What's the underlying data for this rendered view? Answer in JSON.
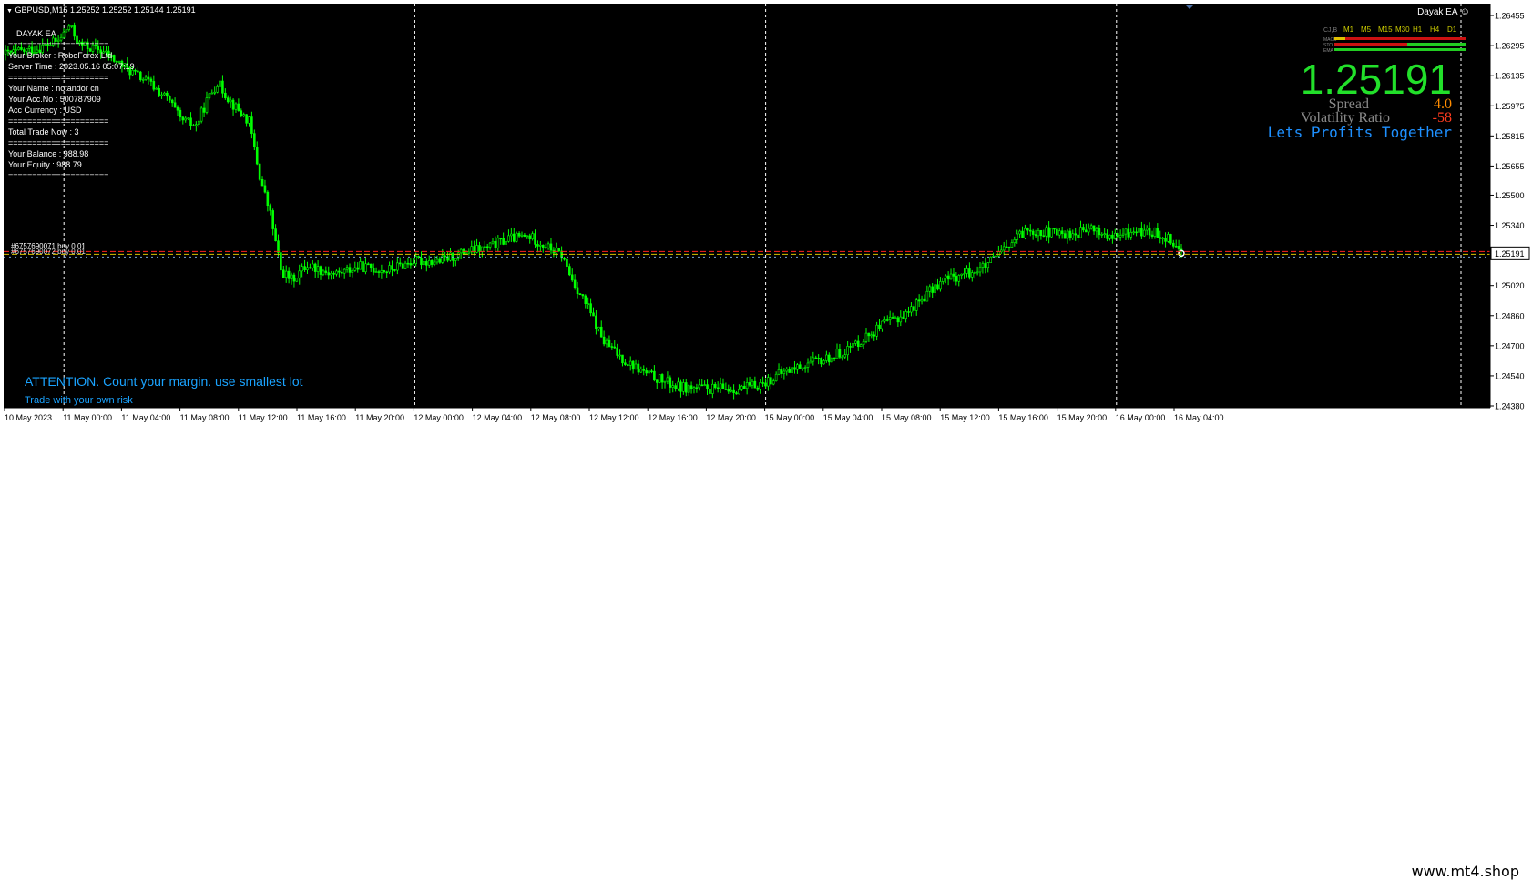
{
  "header": {
    "symbol_line": "GBPUSD,M15  1.25252 1.25252 1.25144 1.25191",
    "ea_badge": "Dayak EA",
    "smiley_icon": "smiley-face-icon"
  },
  "info_panel": {
    "title": "DAYAK EA",
    "lines": [
      "=====================",
      "Your Broker  : RoboForex Ltd",
      "Server Time : 2023.05.16 05:07:19",
      "=====================",
      "Your Name     : notandor cn",
      "Your Acc.No   : 500787909",
      "Acc Currency  : USD",
      "=====================",
      "Total Trade Now : 3",
      "=====================",
      "Your Balance  : 988.98",
      "Your Equity    : 988.79",
      "====================="
    ]
  },
  "order_labels": {
    "line1": "#6757690071 buy 0.01",
    "line2": "#6757690072 buy 0.01"
  },
  "price_panel": {
    "big_price": "1.25191",
    "spread_label": "Spread",
    "spread_value": "4.0",
    "volatility_label": "Volatility Ratio",
    "volatility_value": "-58",
    "slogan": "Lets Profits Together",
    "tf_labels": [
      "M1",
      "M5",
      "M15",
      "M30",
      "H1",
      "H4",
      "D1"
    ],
    "indicator_rows": [
      "CJ,B",
      "MACD",
      "STO",
      "EMA"
    ]
  },
  "attention": {
    "line1": "ATTENTION. Count your margin. use smallest lot",
    "line2": "Trade with your own risk"
  },
  "watermark": "www.mt4.shop",
  "colors": {
    "background": "#000000",
    "candles": "#00ff00",
    "price_green": "#22e02a",
    "spread_orange": "#ff8c00",
    "volatility_red": "#ff3b1f",
    "slogan_blue": "#1e90ff",
    "attention_blue": "#1aa3ff",
    "price_line_red": "#ff2020",
    "price_line_yellow": "#d6c200",
    "grid_white": "#ffffff"
  },
  "chart_data": {
    "type": "candlestick",
    "symbol": "GBPUSD",
    "timeframe": "M15",
    "ylim": [
      1.2438,
      1.2646
    ],
    "y_ticks": [
      "1.26455",
      "1.26295",
      "1.26135",
      "1.25975",
      "1.25815",
      "1.25655",
      "1.25500",
      "1.25340",
      "1.25191",
      "1.25020",
      "1.24860",
      "1.24700",
      "1.24540",
      "1.24380"
    ],
    "current_price": 1.25191,
    "x_ticks": [
      "10 May 2023",
      "11 May 00:00",
      "11 May 04:00",
      "11 May 08:00",
      "11 May 12:00",
      "11 May 16:00",
      "11 May 20:00",
      "12 May 00:00",
      "12 May 04:00",
      "12 May 08:00",
      "12 May 12:00",
      "12 May 16:00",
      "12 May 20:00",
      "15 May 00:00",
      "15 May 04:00",
      "15 May 08:00",
      "15 May 12:00",
      "15 May 16:00",
      "15 May 20:00",
      "16 May 00:00",
      "16 May 04:00"
    ],
    "close_path": [
      [
        0,
        1.2625
      ],
      [
        12,
        1.2628
      ],
      [
        20,
        1.2632
      ],
      [
        24,
        1.264
      ],
      [
        28,
        1.263
      ],
      [
        36,
        1.2627
      ],
      [
        46,
        1.2617
      ],
      [
        54,
        1.261
      ],
      [
        62,
        1.26
      ],
      [
        66,
        1.259
      ],
      [
        72,
        1.2587
      ],
      [
        76,
        1.26
      ],
      [
        80,
        1.261
      ],
      [
        86,
        1.2598
      ],
      [
        92,
        1.2589
      ],
      [
        96,
        1.256
      ],
      [
        100,
        1.254
      ],
      [
        104,
        1.251
      ],
      [
        108,
        1.2505
      ],
      [
        114,
        1.2513
      ],
      [
        124,
        1.2508
      ],
      [
        134,
        1.2512
      ],
      [
        144,
        1.251
      ],
      [
        154,
        1.2515
      ],
      [
        164,
        1.2515
      ],
      [
        174,
        1.252
      ],
      [
        182,
        1.2522
      ],
      [
        190,
        1.2527
      ],
      [
        198,
        1.2528
      ],
      [
        204,
        1.2523
      ],
      [
        210,
        1.2518
      ],
      [
        214,
        1.2505
      ],
      [
        220,
        1.249
      ],
      [
        226,
        1.2472
      ],
      [
        234,
        1.2462
      ],
      [
        242,
        1.2455
      ],
      [
        254,
        1.2448
      ],
      [
        266,
        1.2447
      ],
      [
        278,
        1.2447
      ],
      [
        286,
        1.245
      ],
      [
        294,
        1.2456
      ],
      [
        302,
        1.246
      ],
      [
        310,
        1.2463
      ],
      [
        318,
        1.2468
      ],
      [
        326,
        1.2476
      ],
      [
        334,
        1.2483
      ],
      [
        340,
        1.2487
      ],
      [
        346,
        1.2495
      ],
      [
        354,
        1.2505
      ],
      [
        362,
        1.2508
      ],
      [
        370,
        1.2512
      ],
      [
        378,
        1.2522
      ],
      [
        386,
        1.2532
      ],
      [
        394,
        1.253
      ],
      [
        402,
        1.2529
      ],
      [
        410,
        1.2532
      ],
      [
        418,
        1.2527
      ],
      [
        426,
        1.2531
      ],
      [
        434,
        1.253
      ],
      [
        440,
        1.2527
      ],
      [
        444,
        1.2519
      ]
    ]
  }
}
